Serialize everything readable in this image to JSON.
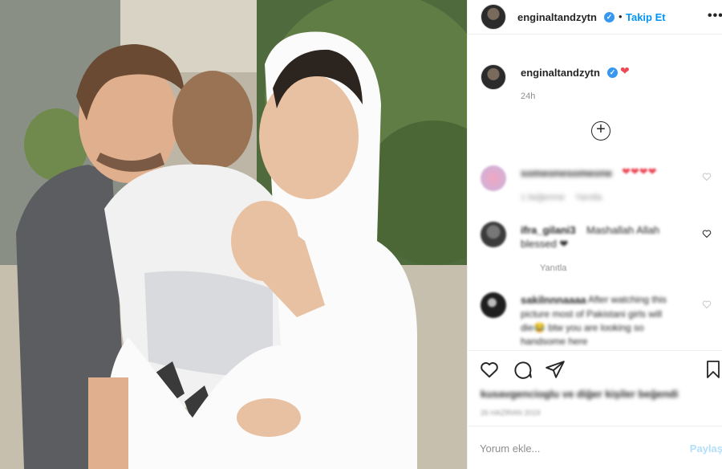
{
  "header": {
    "username": "enginaltandzytn",
    "separator": "•",
    "follow_label": "Takip Et",
    "more_label": "•••",
    "icons": {
      "verified": "verified-badge-icon",
      "more": "more-options-icon"
    }
  },
  "caption": {
    "username": "enginaltandzytn",
    "heart": "❤",
    "time": "24h"
  },
  "load_more": {
    "label": "+",
    "icon": "load-more-plus-icon"
  },
  "comments": [
    {
      "user": "someonesomeone",
      "text": "❤❤❤❤",
      "likes": "1 beğenme",
      "reply": "Yanıtla"
    },
    {
      "user": "ifra_gilani3",
      "text": "Mashallah Allah",
      "text2": "blessed ❤",
      "reply": "Yanıtla"
    },
    {
      "user": "sakilnnnaaaa",
      "text": "After watching this",
      "text2": "picture most of Pakistani girls will",
      "text3": "die😂 btw you are looking so",
      "text4": "handsome here"
    }
  ],
  "actions": {
    "icons": [
      "like-heart-icon",
      "comment-icon",
      "share-icon",
      "save-bookmark-icon"
    ],
    "likes_text": "kusavgencioglu ve diğer kişiler beğendi",
    "date": "26 HAZİRAN 2019"
  },
  "composer": {
    "placeholder": "Yorum ekle...",
    "post_label": "Paylaş"
  },
  "colors": {
    "accent": "#0095f6",
    "verified": "#3897f0",
    "heart": "#ed4956",
    "post_disabled": "#b2dffc",
    "muted": "#8e8e8e",
    "border": "#efefef"
  }
}
